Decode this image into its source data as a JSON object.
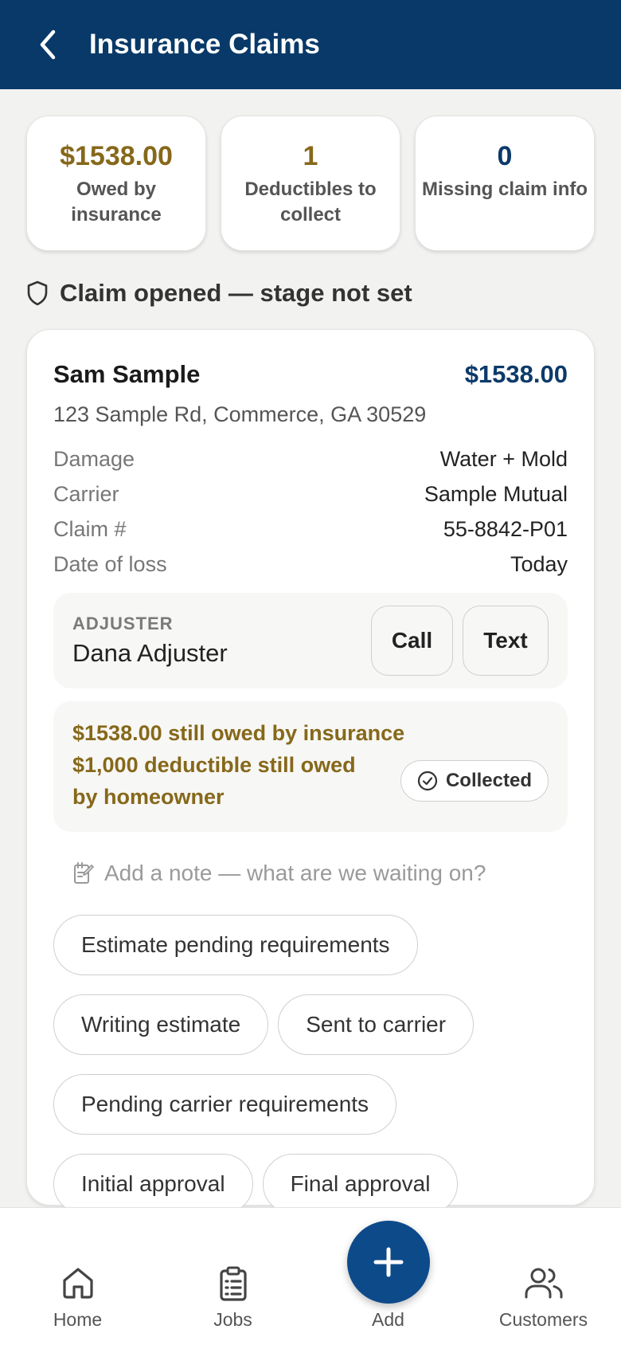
{
  "header": {
    "title": "Insurance Claims"
  },
  "stats": [
    {
      "value": "$1538.00",
      "label": "Owed by insurance",
      "color": "#86681a"
    },
    {
      "value": "1",
      "label": "Deductibles to collect",
      "color": "#86681a"
    },
    {
      "value": "0",
      "label": "Missing claim info",
      "color": "#0c3a69"
    }
  ],
  "stage": {
    "title": "Claim opened — stage not set"
  },
  "claim": {
    "customer_name": "Sam Sample",
    "amount": "$1538.00",
    "address": "123 Sample Rd, Commerce, GA 30529",
    "details": [
      {
        "label": "Damage",
        "value": "Water + Mold"
      },
      {
        "label": "Carrier",
        "value": "Sample Mutual"
      },
      {
        "label": "Claim #",
        "value": "55-8842-P01"
      },
      {
        "label": "Date of loss",
        "value": "Today"
      }
    ],
    "adjuster": {
      "kicker": "ADJUSTER",
      "name": "Dana Adjuster",
      "call_label": "Call",
      "text_label": "Text"
    },
    "owed": {
      "insurance_line": "$1538.00 still owed by insurance",
      "deductible_line": "$1,000 deductible still owed by homeowner",
      "collected_label": "Collected"
    },
    "note": {
      "placeholder": "Add a note — what are we waiting on?"
    },
    "stages": [
      "Estimate pending requirements",
      "Writing estimate",
      "Sent to carrier",
      "Pending carrier requirements",
      "Initial approval",
      "Final approval"
    ]
  },
  "nav": {
    "items": [
      {
        "label": "Home",
        "icon": "home-icon"
      },
      {
        "label": "Jobs",
        "icon": "clipboard-icon"
      },
      {
        "label": "Add",
        "icon": "plus-icon"
      },
      {
        "label": "Customers",
        "icon": "users-icon"
      }
    ]
  },
  "colors": {
    "header": "#083968",
    "accent_gold": "#86681a",
    "accent_navy": "#0c3a69",
    "fab": "#0d4a8a"
  }
}
